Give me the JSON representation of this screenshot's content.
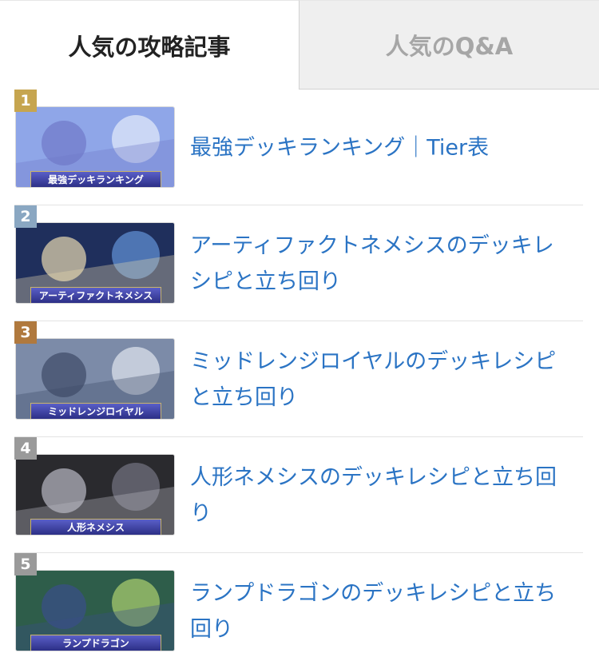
{
  "tabs": {
    "active_label": "人気の攻略記事",
    "inactive_label": "人気のQ&A"
  },
  "articles": [
    {
      "rank": "1",
      "title": "最強デッキランキング｜Tier表",
      "banner": "最強デッキランキング",
      "badge_color": "#c6a54f",
      "thumb_colors": [
        "#8fa6e8",
        "#d9e3f7",
        "#6f79c9"
      ]
    },
    {
      "rank": "2",
      "title": "アーティファクトネメシスのデッキレシピと立ち回り",
      "banner": "アーティファクトネメシス",
      "badge_color": "#8aa7c2",
      "thumb_colors": [
        "#1f2f5c",
        "#5a87c9",
        "#e8d9b0"
      ]
    },
    {
      "rank": "3",
      "title": "ミッドレンジロイヤルのデッキレシピと立ち回り",
      "banner": "ミッドレンジロイヤル",
      "badge_color": "#b0793e",
      "thumb_colors": [
        "#7c8ba8",
        "#d5dbe6",
        "#3d4a66"
      ]
    },
    {
      "rank": "4",
      "title": "人形ネメシスのデッキレシピと立ち回り",
      "banner": "人形ネメシス",
      "badge_color": "#9a9a9a",
      "thumb_colors": [
        "#2a2a2e",
        "#6b6b78",
        "#b9b9c4"
      ]
    },
    {
      "rank": "5",
      "title": "ランプドラゴンのデッキレシピと立ち回り",
      "banner": "ランプドラゴン",
      "badge_color": "#9a9a9a",
      "thumb_colors": [
        "#2e5d4a",
        "#9ec36a",
        "#3a4e8a"
      ]
    }
  ]
}
